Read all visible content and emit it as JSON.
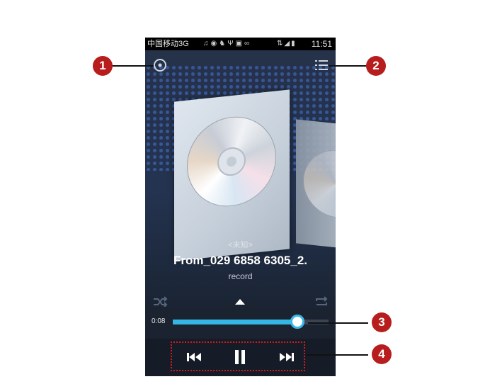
{
  "status_bar": {
    "carrier": "中国移动3G",
    "time": "11:51",
    "left_icons": [
      "music-note-icon",
      "sync-icon",
      "android-icon",
      "usb-icon",
      "image-icon",
      "voicemail-icon"
    ],
    "right_icons": [
      "network-icon",
      "signal-icon",
      "battery-icon"
    ]
  },
  "toolbar": {
    "left_icon": "disc-icon",
    "right_icon": "playlist-icon"
  },
  "now_playing": {
    "artist": "<未知>",
    "title": "From_029 6858 6305_2.",
    "album": "record"
  },
  "controls": {
    "shuffle_icon": "shuffle-icon",
    "expand_icon": "expand-up-icon",
    "repeat_icon": "repeat-icon",
    "prev_icon": "previous-icon",
    "pause_icon": "pause-icon",
    "next_icon": "next-icon"
  },
  "progress": {
    "elapsed": "0:08",
    "fraction": 0.8
  },
  "callouts": [
    "1",
    "2",
    "3",
    "4"
  ],
  "colors": {
    "accent": "#34b6e5",
    "callout": "#b71d1d",
    "highlight_box": "#d01c1c"
  }
}
